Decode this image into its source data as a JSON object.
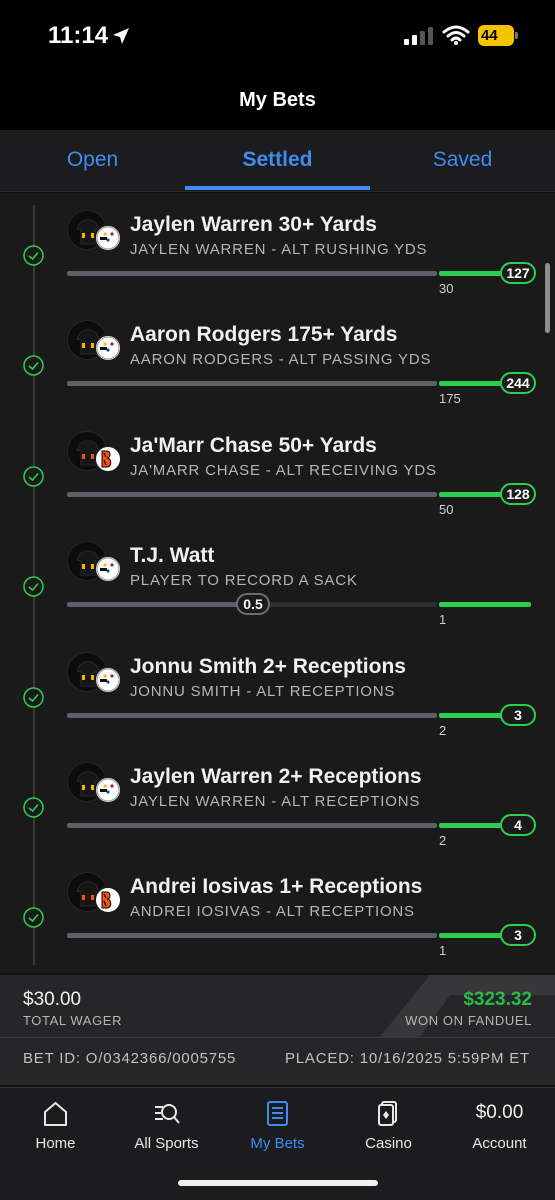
{
  "status": {
    "time": "11:14",
    "battery": "44"
  },
  "header": {
    "title": "My Bets"
  },
  "tabs": [
    {
      "label": "Open",
      "active": false
    },
    {
      "label": "Settled",
      "active": true
    },
    {
      "label": "Saved",
      "active": false
    }
  ],
  "legs": [
    {
      "title": "Jaylen Warren 30+ Yards",
      "subtitle": "JAYLEN WARREN - ALT RUSHING YDS",
      "target": "30",
      "result": "127",
      "team": "steelers",
      "status": "won"
    },
    {
      "title": "Aaron Rodgers 175+ Yards",
      "subtitle": "AARON RODGERS - ALT PASSING YDS",
      "target": "175",
      "result": "244",
      "team": "steelers",
      "status": "won"
    },
    {
      "title": "Ja'Marr Chase 50+ Yards",
      "subtitle": "JA'MARR CHASE - ALT RECEIVING YDS",
      "target": "50",
      "result": "128",
      "team": "bengals",
      "status": "won"
    },
    {
      "title": "T.J. Watt",
      "subtitle": "PLAYER TO RECORD A SACK",
      "target": "1",
      "result": "0.5",
      "team": "steelers",
      "status": "won"
    },
    {
      "title": "Jonnu Smith 2+ Receptions",
      "subtitle": "JONNU SMITH - ALT RECEPTIONS",
      "target": "2",
      "result": "3",
      "team": "steelers",
      "status": "won"
    },
    {
      "title": "Jaylen Warren 2+ Receptions",
      "subtitle": "JAYLEN WARREN - ALT RECEPTIONS",
      "target": "2",
      "result": "4",
      "team": "steelers",
      "status": "won"
    },
    {
      "title": "Andrei Iosivas 1+ Receptions",
      "subtitle": "ANDREI IOSIVAS - ALT RECEPTIONS",
      "target": "1",
      "result": "3",
      "team": "bengals",
      "status": "won"
    }
  ],
  "summary": {
    "wager_amount": "$30.00",
    "wager_label": "TOTAL WAGER",
    "won_amount": "$323.32",
    "won_label": "WON ON FANDUEL",
    "bet_id": "BET ID: O/0342366/0005755",
    "placed": "PLACED: 10/16/2025 5:59PM ET"
  },
  "nav": [
    {
      "label": "Home",
      "icon": "home-icon"
    },
    {
      "label": "All Sports",
      "icon": "sports-search-icon"
    },
    {
      "label": "My Bets",
      "icon": "bet-slip-icon",
      "active": true
    },
    {
      "label": "Casino",
      "icon": "cards-icon"
    },
    {
      "label": "Account",
      "amount": "$0.00"
    }
  ],
  "colors": {
    "accent": "#3f8cf0",
    "win": "#2ecc4f",
    "won_text": "#2db84d",
    "background": "#1a1a1a"
  }
}
